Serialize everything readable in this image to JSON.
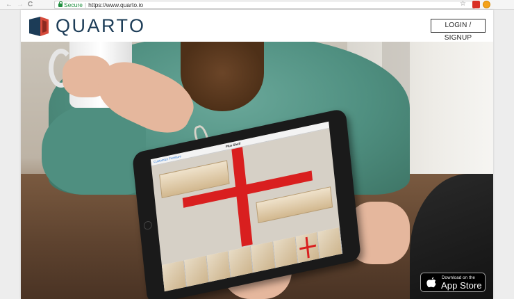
{
  "browser": {
    "back_glyph": "←",
    "forward_glyph": "→",
    "reload_glyph": "C",
    "secure_label": "Secure",
    "url": "https://www.quarto.io",
    "star_glyph": "☆"
  },
  "header": {
    "brand": "QUARTO",
    "login_label": "LOGIN / SIGNUP"
  },
  "tablet": {
    "back_link": "Customize Furniture",
    "title": "Plus Shelf"
  },
  "appstore": {
    "small_label": "Download on the",
    "big_label": "App Store"
  },
  "colors": {
    "brand_navy": "#1c3c57",
    "brand_red": "#d64a3a",
    "accent_red": "#d91f1f"
  }
}
